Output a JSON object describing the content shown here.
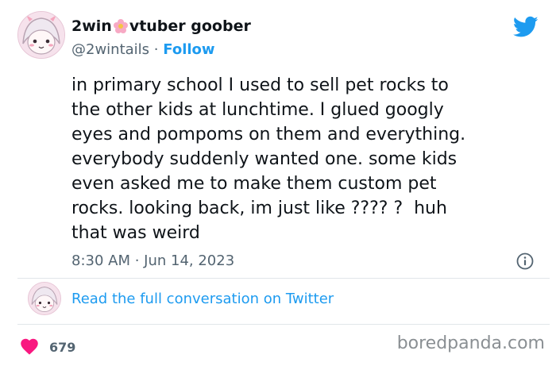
{
  "author": {
    "display_name_part1": "2win",
    "display_name_part2": "vtuber goober",
    "handle": "@2wintails",
    "separator": "·",
    "follow_label": "Follow"
  },
  "tweet": {
    "text": "in primary school I used to sell pet rocks to\nthe other kids at lunchtime. I glued googly\neyes and pompoms on them and everything.\neverybody suddenly wanted one. some kids\neven asked me to make them custom pet\nrocks. looking back, im just like ???? ?  huh\nthat was weird",
    "timestamp": "8:30 AM · Jun 14, 2023"
  },
  "conversation": {
    "link_label": "Read the full conversation on Twitter"
  },
  "engagement": {
    "likes": "679"
  },
  "watermark": "boredpanda.com",
  "colors": {
    "link": "#1d9bf0",
    "heart": "#f91880",
    "muted": "#536471"
  },
  "icons": [
    "twitter-bird-icon",
    "flower-icon",
    "info-icon",
    "heart-icon"
  ]
}
